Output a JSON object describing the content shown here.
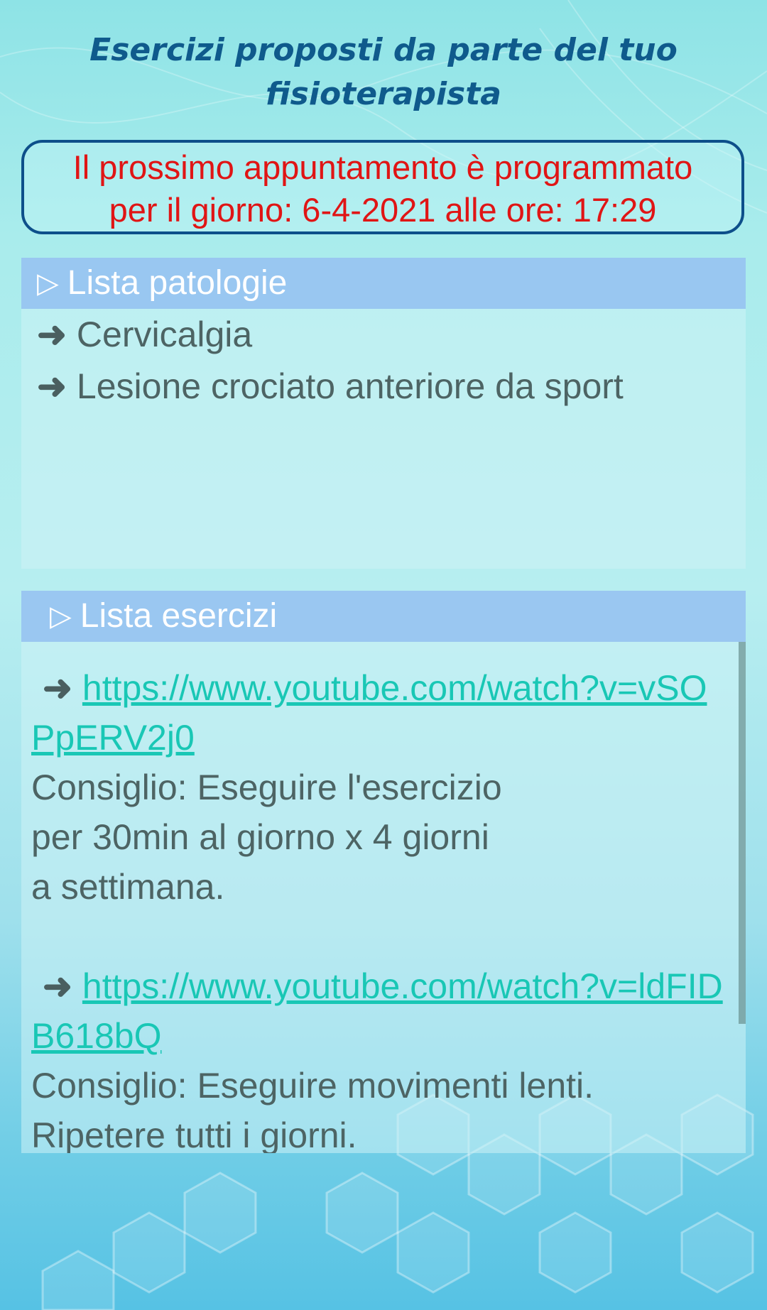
{
  "header": {
    "title_line1": "Esercizi proposti da parte del tuo",
    "title_line2": "fisioterapista"
  },
  "appointment": {
    "line1": "Il prossimo appuntamento è programmato",
    "line2": "per il giorno: 6-4-2021 alle ore: 17:29"
  },
  "pathologies": {
    "header": "Lista patologie",
    "header_icon": "▷",
    "items": [
      {
        "label": "Cervicalgia"
      },
      {
        "label": "Lesione crociato anteriore da sport"
      }
    ]
  },
  "exercises": {
    "header": "Lista esercizi",
    "header_icon": "▷",
    "items": [
      {
        "url": "https://www.youtube.com/watch?v=vSOPpERV2j0",
        "tip": " Consiglio: Eseguire l'esercizio\nper 30min al giorno x 4 giorni\na settimana."
      },
      {
        "url": "https://www.youtube.com/watch?v=ldFIDB618bQ",
        "tip": " Consiglio: Eseguire movimenti lenti.\nRipetere tutti i giorni."
      }
    ]
  },
  "colors": {
    "title": "#0f5a8c",
    "appointment_text": "#e01515",
    "appointment_border": "#0d4f8a",
    "panel_header": "#8cb9f0",
    "link": "#19c7b5",
    "body_text": "#4d6464"
  },
  "icons": {
    "list_bullet": "arrow-right-icon",
    "panel_header": "play-triangle-icon"
  }
}
